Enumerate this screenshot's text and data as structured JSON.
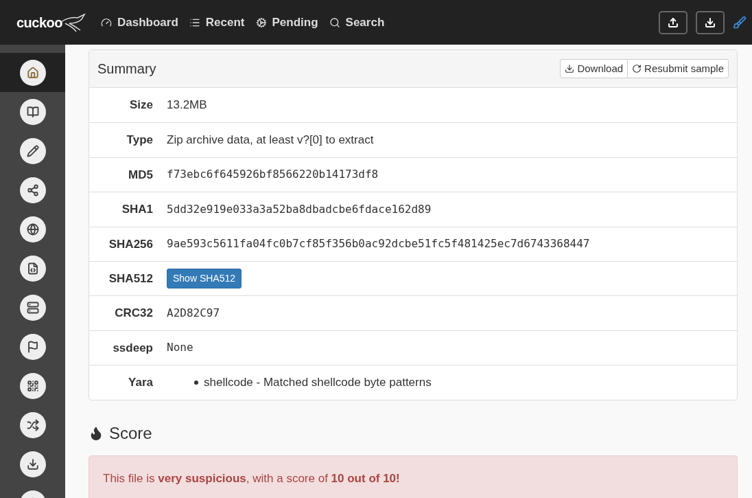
{
  "navbar": {
    "logo": "cuckoo",
    "links": [
      {
        "label": "Dashboard"
      },
      {
        "label": "Recent"
      },
      {
        "label": "Pending"
      },
      {
        "label": "Search"
      }
    ]
  },
  "sidebar": {
    "items": [
      {
        "selected": true
      },
      {
        "selected": false
      },
      {
        "selected": false
      },
      {
        "selected": false
      },
      {
        "selected": false
      },
      {
        "selected": false
      },
      {
        "selected": false
      },
      {
        "selected": false
      },
      {
        "selected": false
      },
      {
        "selected": false
      },
      {
        "selected": false
      },
      {
        "selected": false
      }
    ]
  },
  "summary": {
    "title": "Summary",
    "buttons": [
      "Download",
      "Resubmit sample"
    ],
    "rows": [
      {
        "label": "Size",
        "kind": "text",
        "value": "13.2MB"
      },
      {
        "label": "Type",
        "kind": "text",
        "value": "Zip archive data, at least v?[0] to extract"
      },
      {
        "label": "MD5",
        "kind": "mono",
        "value": "f73ebc6f645926bf8566220b14173df8"
      },
      {
        "label": "SHA1",
        "kind": "mono",
        "value": "5dd32e919e033a3a52ba8dbadcbe6fdace162d89"
      },
      {
        "label": "SHA256",
        "kind": "mono",
        "value": "9ae593c5611fa04fc0b7cf85f356b0ac92dcbe51fc5f481425ec7d6743368447"
      },
      {
        "label": "SHA512",
        "kind": "button",
        "value": "Show SHA512"
      },
      {
        "label": "CRC32",
        "kind": "mono",
        "value": "A2D82C97"
      },
      {
        "label": "ssdeep",
        "kind": "mono",
        "value": "None"
      },
      {
        "label": "Yara",
        "kind": "list",
        "items": [
          "shellcode - Matched shellcode byte patterns"
        ]
      }
    ]
  },
  "score": {
    "title": "Score",
    "message": "This file is **very suspicious**, with a score of **10 out of 10!**"
  }
}
